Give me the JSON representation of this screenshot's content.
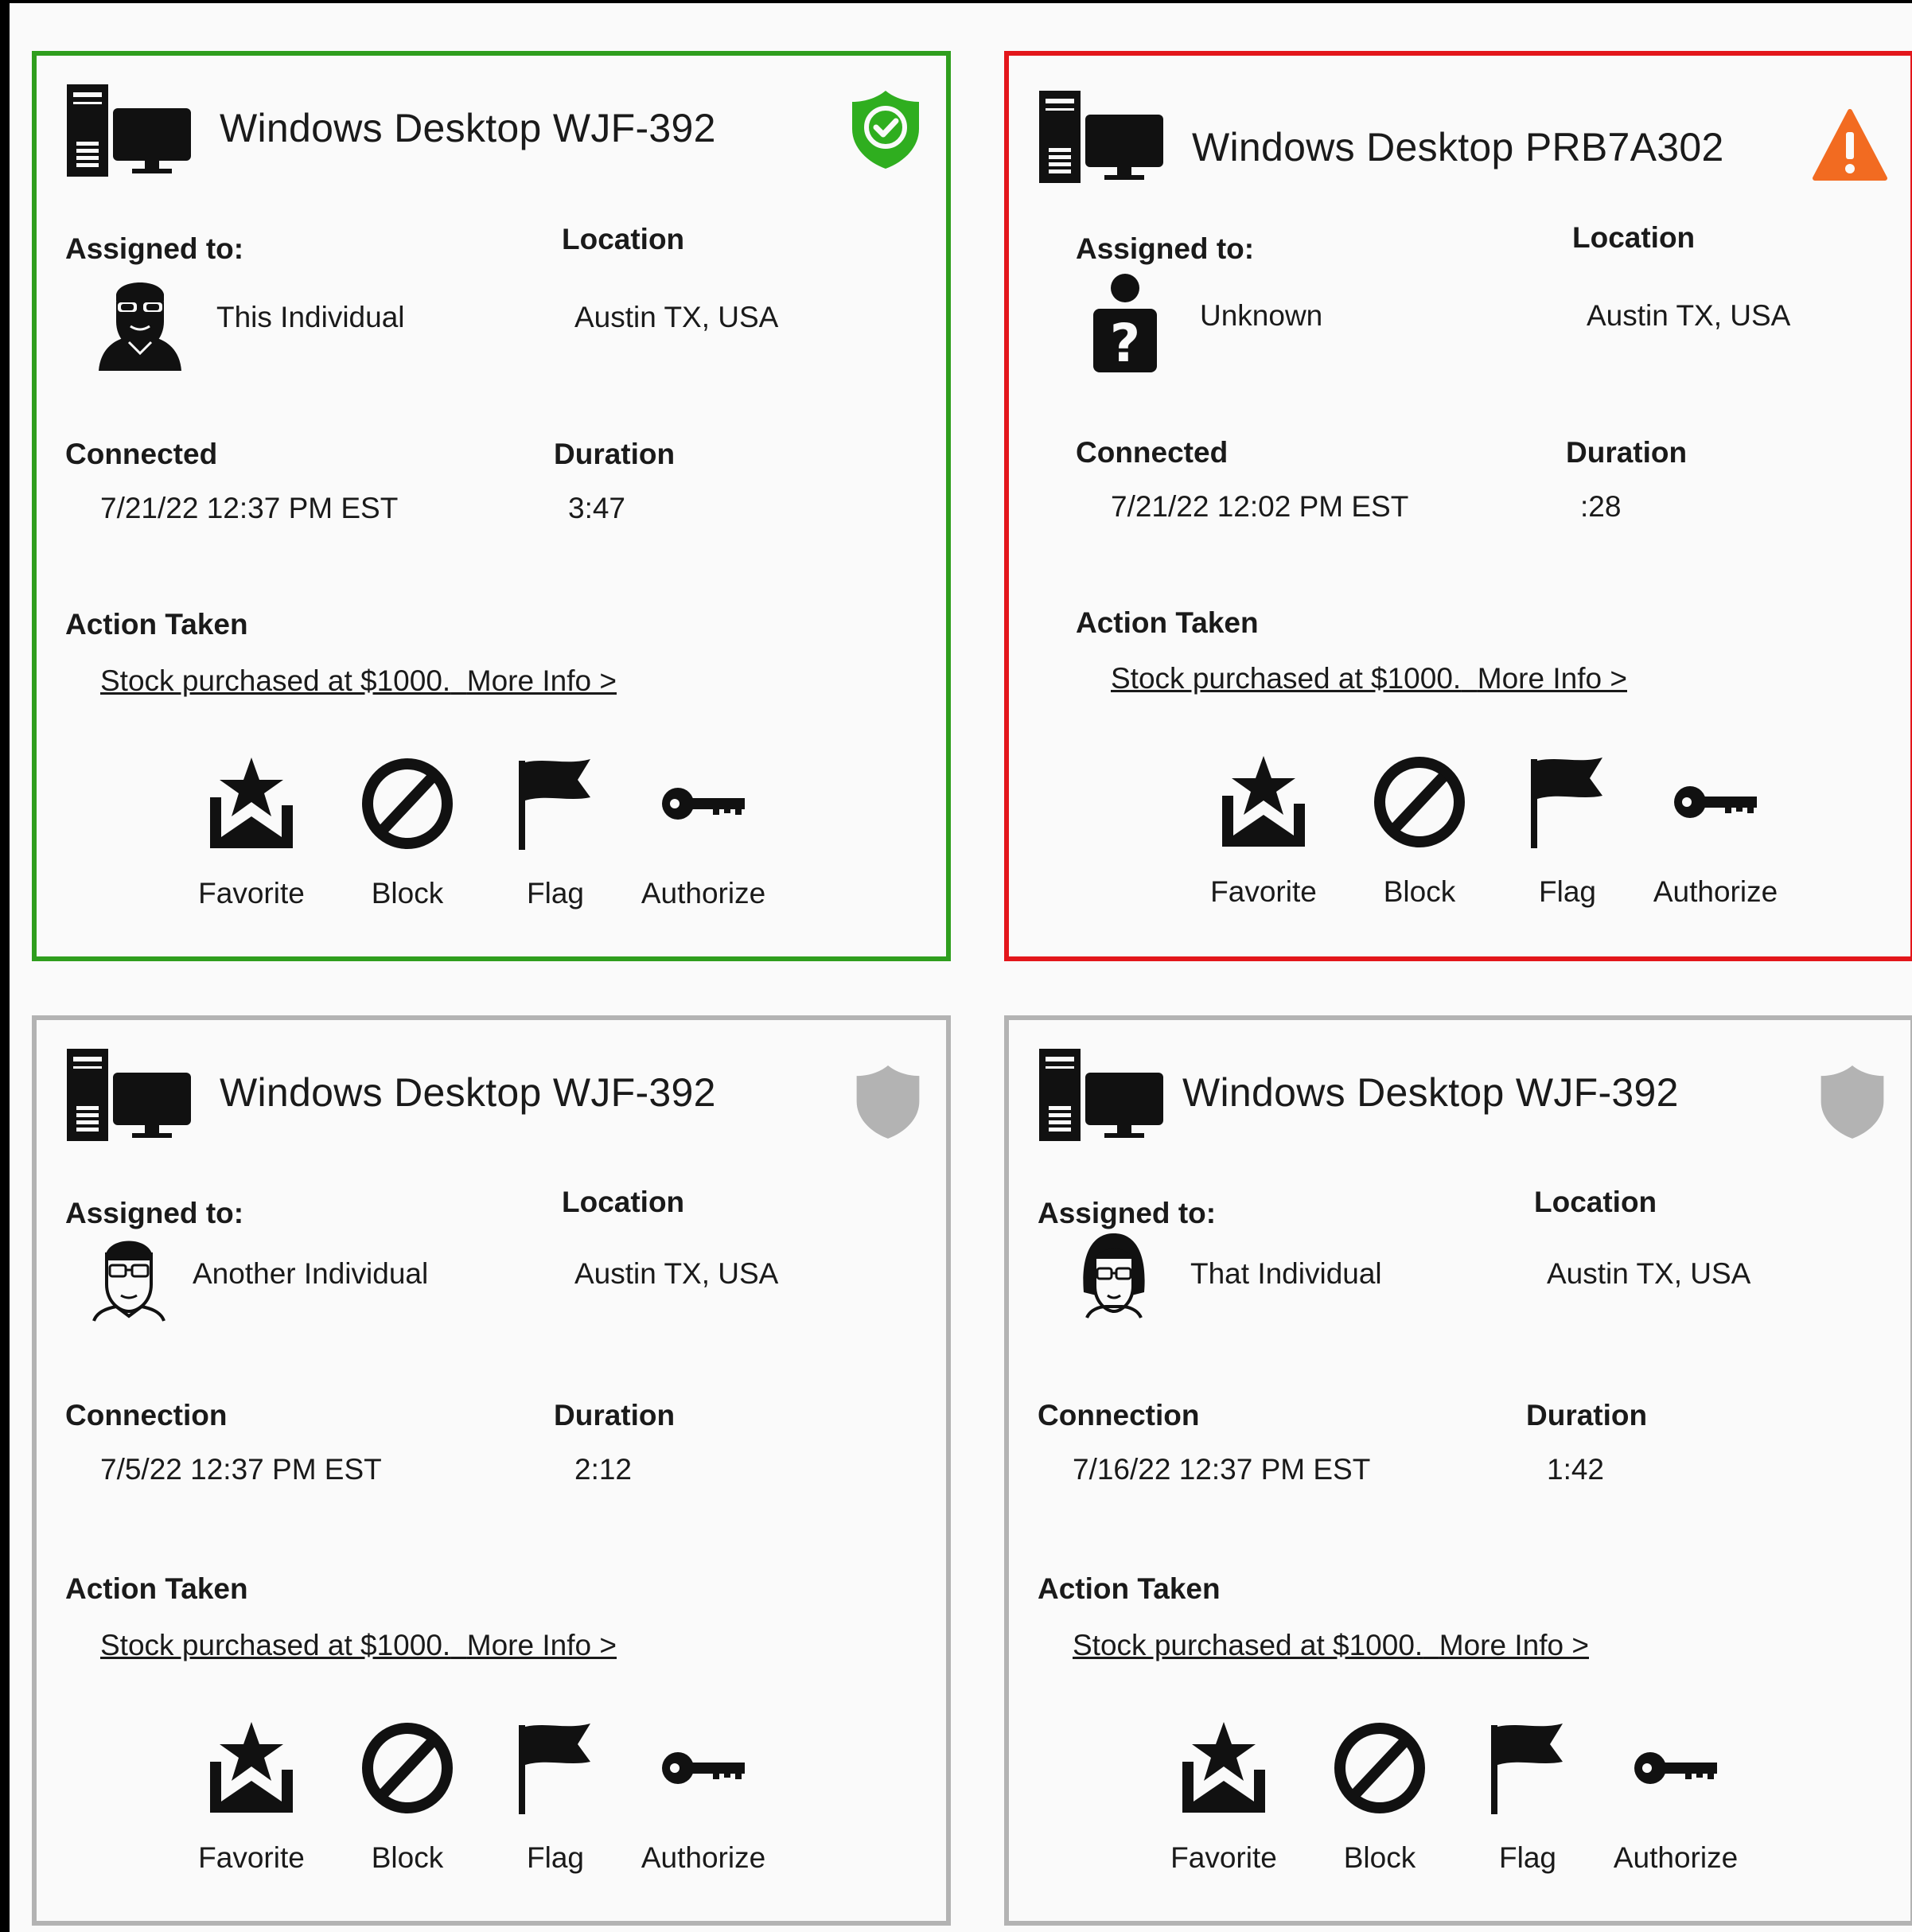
{
  "colors": {
    "authorized_border": "#2f9e1e",
    "alert_border": "#e3161b",
    "neutral_border": "#b3b3b3",
    "shield_green": "#2fae1f",
    "warning_orange": "#f26b21",
    "shield_gray": "#b3b3b3"
  },
  "cards": [
    {
      "title": "Windows Desktop WJF-392",
      "status_icon": "shield-check-icon",
      "assigned_label": "Assigned to:",
      "assigned_value": "This Individual",
      "avatar_icon": "bearded-man-avatar-icon",
      "location_label": "Location",
      "location_value": "Austin TX, USA",
      "connected_label": "Connected",
      "connected_value": "7/21/22  12:37 PM EST",
      "duration_label": "Duration",
      "duration_value": "3:47",
      "action_label": "Action Taken",
      "action_text": "Stock purchased at $1000.",
      "more_info": "More Info >",
      "buttons": [
        "Favorite",
        "Block",
        "Flag",
        "Authorize"
      ]
    },
    {
      "title": "Windows Desktop PRB7A302",
      "status_icon": "warning-triangle-icon",
      "assigned_label": "Assigned to:",
      "assigned_value": "Unknown",
      "avatar_icon": "unknown-person-icon",
      "location_label": "Location",
      "location_value": "Austin TX, USA",
      "connected_label": "Connected",
      "connected_value": "7/21/22  12:02 PM EST",
      "duration_label": "Duration",
      "duration_value": ":28",
      "action_label": "Action Taken",
      "action_text": "Stock purchased at $1000.",
      "more_info": "More Info >",
      "buttons": [
        "Favorite",
        "Block",
        "Flag",
        "Authorize"
      ]
    },
    {
      "title": "Windows Desktop WJF-392",
      "status_icon": "shield-gray-icon",
      "assigned_label": "Assigned to:",
      "assigned_value": "Another Individual",
      "avatar_icon": "man-glasses-avatar-icon",
      "location_label": "Location",
      "location_value": "Austin TX, USA",
      "connected_label": "Connection",
      "connected_value": "7/5/22  12:37 PM EST",
      "duration_label": "Duration",
      "duration_value": "2:12",
      "action_label": "Action Taken",
      "action_text": "Stock purchased at $1000.",
      "more_info": "More Info >",
      "buttons": [
        "Favorite",
        "Block",
        "Flag",
        "Authorize"
      ]
    },
    {
      "title": "Windows Desktop WJF-392",
      "status_icon": "shield-gray-icon",
      "assigned_label": "Assigned to:",
      "assigned_value": "That Individual",
      "avatar_icon": "woman-glasses-avatar-icon",
      "location_label": "Location",
      "location_value": "Austin TX, USA",
      "connected_label": "Connection",
      "connected_value": "7/16/22  12:37 PM EST",
      "duration_label": "Duration",
      "duration_value": "1:42",
      "action_label": "Action Taken",
      "action_text": "Stock purchased at $1000.",
      "more_info": "More Info >",
      "buttons": [
        "Favorite",
        "Block",
        "Flag",
        "Authorize"
      ]
    }
  ]
}
